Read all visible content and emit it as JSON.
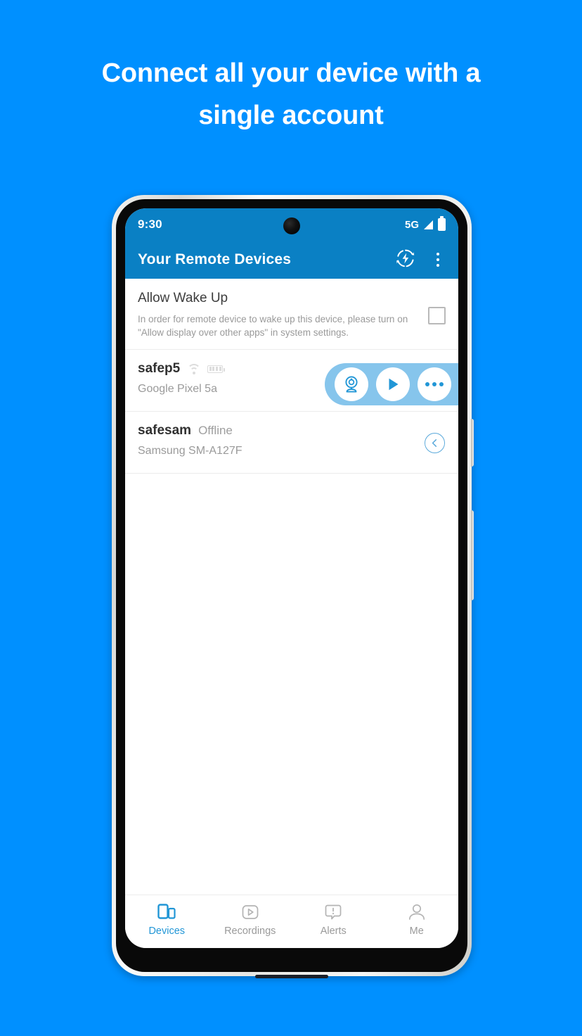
{
  "headline": "Connect all your device with a single account",
  "colors": {
    "background": "#0090ff",
    "appbar": "#0a80c4",
    "accent": "#2196d6",
    "pill": "#86c5ec",
    "muted": "#9a9a9a"
  },
  "statusbar": {
    "time": "9:30",
    "network": "5G",
    "signal_icon": "signal-triangle-icon",
    "battery_icon": "battery-icon",
    "camera_icon": "front-camera-punch-hole-icon"
  },
  "appbar": {
    "title": "Your Remote Devices",
    "refresh_icon": "flash-refresh-icon",
    "overflow_icon": "kebab-menu-icon"
  },
  "wake": {
    "title": "Allow Wake Up",
    "description": "In order for remote device to wake up this device, please turn on \"Allow display over other apps\" in system settings.",
    "checked": false
  },
  "devices": [
    {
      "name": "safep5",
      "status": "",
      "model": "Google Pixel 5a",
      "wifi_icon": "wifi-icon",
      "battery_icon": "battery-small-icon",
      "actions": [
        {
          "name": "webcam-button",
          "icon": "webcam-icon"
        },
        {
          "name": "play-button",
          "icon": "play-icon"
        },
        {
          "name": "more-button",
          "icon": "more-dots-icon"
        }
      ]
    },
    {
      "name": "safesam",
      "status": "Offline",
      "model": "Samsung SM-A127F",
      "expand_icon": "chevron-left-circle-icon"
    }
  ],
  "bottomnav": {
    "items": [
      {
        "label": "Devices",
        "icon": "devices-icon",
        "active": true
      },
      {
        "label": "Recordings",
        "icon": "recordings-icon",
        "active": false
      },
      {
        "label": "Alerts",
        "icon": "alerts-icon",
        "active": false
      },
      {
        "label": "Me",
        "icon": "profile-icon",
        "active": false
      }
    ]
  }
}
